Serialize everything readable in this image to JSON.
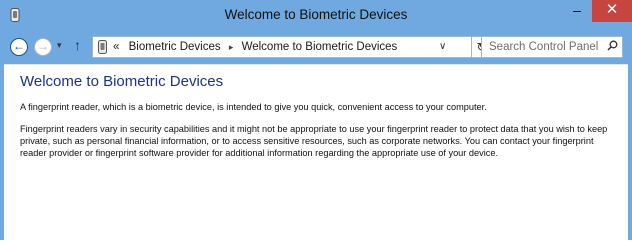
{
  "window": {
    "title": "Welcome to Biometric Devices",
    "minimize_glyph": "–",
    "maximize_glyph": "▢",
    "close_glyph": "✕"
  },
  "navigation": {
    "back_glyph": "←",
    "forward_glyph": "→",
    "recent_glyph": "▾",
    "up_glyph": "↑"
  },
  "address_bar": {
    "prefix": "«",
    "crumbs": [
      "Biometric Devices",
      "Welcome to Biometric Devices"
    ],
    "separator": "▸",
    "dropdown_glyph": "∨",
    "refresh_glyph": "↻"
  },
  "search": {
    "placeholder": "Search Control Panel",
    "icon": "search-icon"
  },
  "content": {
    "heading": "Welcome to Biometric Devices",
    "paragraph1": "A fingerprint reader, which is a biometric device, is intended to give you quick, convenient access to your computer.",
    "paragraph2": "Fingerprint readers vary in security capabilities and it might not be appropriate to use your fingerprint reader to protect data that you wish to keep private, such as personal financial information, or to access sensitive resources, such as corporate networks. You can contact your fingerprint reader provider or fingerprint software provider for additional information regarding the appropriate use of your device."
  },
  "colors": {
    "frame": "#6fa9e0",
    "heading": "#1e3287",
    "close_button": "#c7453f"
  }
}
